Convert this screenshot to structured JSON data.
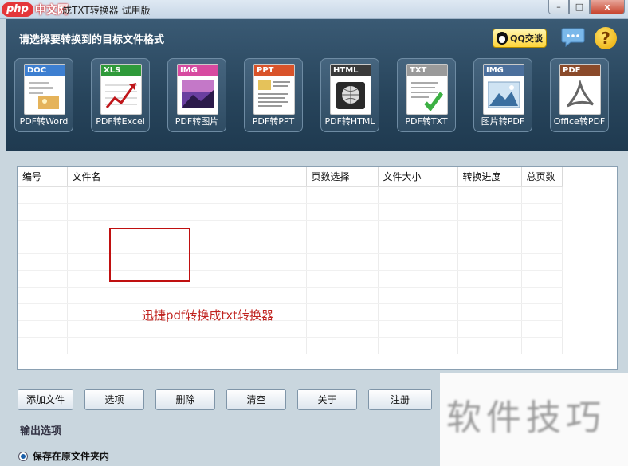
{
  "titlebar": {
    "logo_badge": "php",
    "logo_text": "中文网",
    "title": "成TXT转换器 试用版",
    "min": "–",
    "max": "□",
    "close": "x"
  },
  "header": {
    "prompt": "请选择要转换到的目标文件格式",
    "qq_label": "QQ交谈",
    "help_glyph": "?"
  },
  "tools": [
    {
      "tag": "DOC",
      "label": "PDF转Word",
      "color": "#3d7fd1"
    },
    {
      "tag": "XLS",
      "label": "PDF转Excel",
      "color": "#2f9a3a"
    },
    {
      "tag": "IMG",
      "label": "PDF转图片",
      "color": "#d74aa0"
    },
    {
      "tag": "PPT",
      "label": "PDF转PPT",
      "color": "#d9532a"
    },
    {
      "tag": "HTML",
      "label": "PDF转HTML",
      "color": "#3a3a3a"
    },
    {
      "tag": "TXT",
      "label": "PDF转TXT",
      "color": "#9a9a9a"
    },
    {
      "tag": "IMG",
      "label": "图片转PDF",
      "color": "#4b6f9c"
    },
    {
      "tag": "PDF",
      "label": "Office转PDF",
      "color": "#8a4a2a"
    }
  ],
  "table": {
    "columns": [
      "编号",
      "文件名",
      "页数选择",
      "文件大小",
      "转换进度",
      "总页数"
    ]
  },
  "caption": "迅捷pdf转换成txt转换器",
  "buttons": {
    "add": "添加文件",
    "options": "选项",
    "delete": "删除",
    "clear": "清空",
    "about": "关于",
    "register": "注册"
  },
  "output": {
    "label": "输出选项",
    "radio": "保存在原文件夹内"
  },
  "watermark": "软件技巧"
}
